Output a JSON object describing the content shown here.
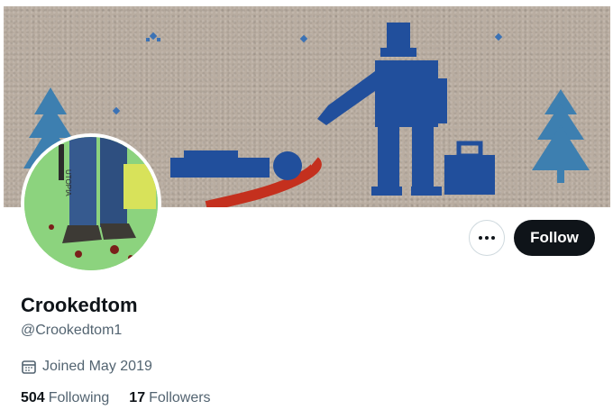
{
  "profile": {
    "display_name": "Crookedtom",
    "handle": "@Crookedtom1",
    "joined": "Joined May 2019"
  },
  "stats": {
    "following_count": "504",
    "following_label": "Following",
    "followers_count": "17",
    "followers_label": "Followers"
  },
  "actions": {
    "follow_label": "Follow",
    "more_icon": "more-horizontal-icon"
  },
  "banner": {
    "description_icon": "cross-stitch-banner",
    "colors": {
      "fabric": "#b9ada1",
      "thread_blue": "#214f9c",
      "tree_blue": "#3d7fb0",
      "red": "#c4301e"
    }
  },
  "avatar": {
    "text": "UTOPIA",
    "colors": {
      "background": "#8cd37e"
    }
  },
  "colors": {
    "primary_text": "#0f1419",
    "secondary_text": "#536471",
    "button_dark": "#0f1419",
    "border": "#cfd9de"
  }
}
